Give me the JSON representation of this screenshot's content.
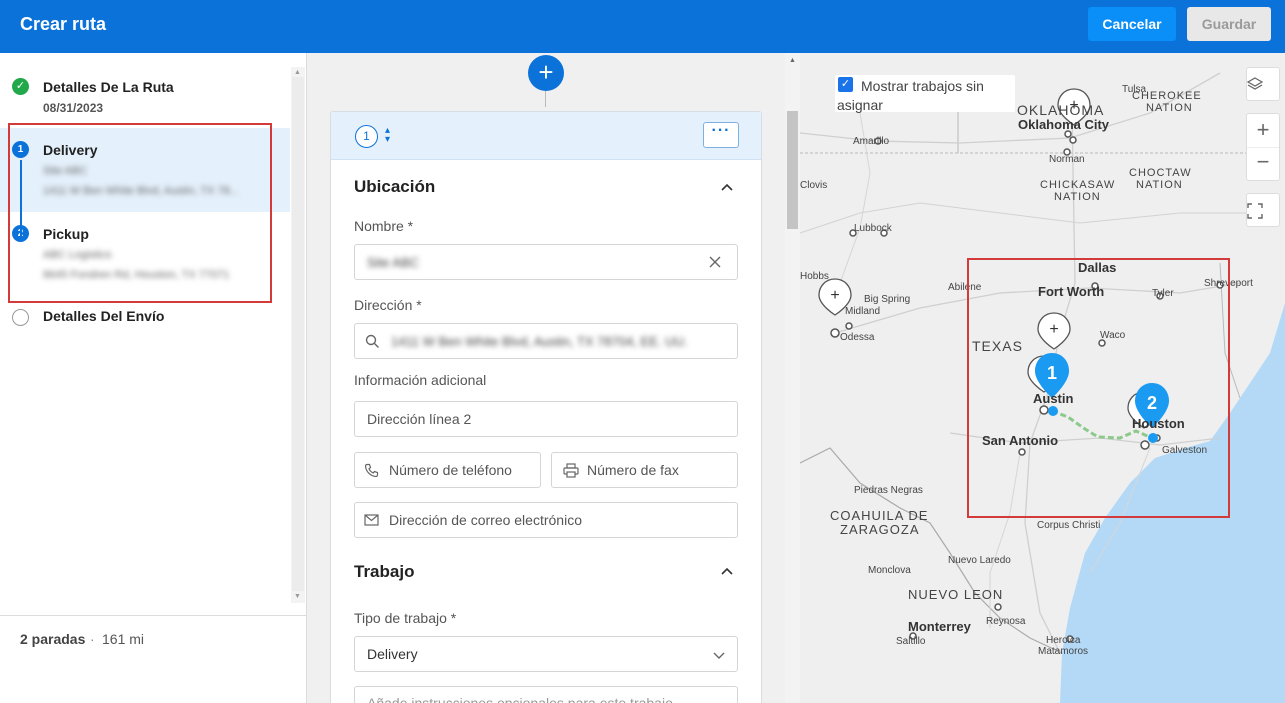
{
  "header": {
    "title": "Crear ruta",
    "cancel_label": "Cancelar",
    "save_label": "Guardar"
  },
  "sidebar": {
    "steps": [
      {
        "label": "Detalles De La Ruta",
        "sub": "08/31/2023"
      },
      {
        "label": "Delivery",
        "number": "1",
        "line1": "Site ABC",
        "line2": "1411 W Ben White Blvd, Austin, TX 78..."
      },
      {
        "label": "Pickup",
        "number": "2",
        "line1": "ABC Logistics",
        "line2": "8645 Fondren Rd, Houston, TX 77071"
      },
      {
        "label": "Detalles Del Envío"
      }
    ],
    "footer": {
      "stops": "2 paradas",
      "separator": "·",
      "miles": "161 mi"
    }
  },
  "stop_card": {
    "number": "1",
    "more_label": "···",
    "location": {
      "title": "Ubicación",
      "name_label": "Nombre *",
      "name_value": "Site ABC",
      "address_label": "Dirección *",
      "address_value": "1411 W Ben White Blvd, Austin, TX 78704, EE. UU.",
      "extra_label": "Información adicional",
      "line2_placeholder": "Dirección línea 2",
      "phone_placeholder": "Número de teléfono",
      "fax_placeholder": "Número de fax",
      "email_placeholder": "Dirección de correo electrónico"
    },
    "job": {
      "title": "Trabajo",
      "type_label": "Tipo de trabajo *",
      "type_value": "Delivery",
      "instructions_placeholder": "Añade instrucciones opcionales para este trabajo"
    }
  },
  "map": {
    "show_unassigned_label": "Mostrar trabajos sin asignar",
    "show_unassigned_checked": true,
    "labels": {
      "oklahoma": "OKLAHOMA",
      "oklahoma_city": "Oklahoma City",
      "norman": "Norman",
      "amarillo": "Amarillo",
      "clovis": "Clovis",
      "lubbock": "Lubbock",
      "hobbs": "Hobbs",
      "midland": "Midland",
      "odessa": "Odessa",
      "big_spring": "Big Spring",
      "abilene": "Abilene",
      "dallas": "Dallas",
      "fort_worth": "Fort Worth",
      "tyler": "Tyler",
      "shreveport": "Shreveport",
      "waco": "Waco",
      "texas": "TEXAS",
      "austin": "Austin",
      "san_antonio": "San Antonio",
      "houston": "Houston",
      "galveston": "Galveston",
      "tulsa": "Tulsa",
      "cherokee": "CHEROKEE",
      "nation": "NATION",
      "chickasaw": "CHICKASAW",
      "choctaw": "CHOCTAW",
      "piedras_negras": "Piedras Negras",
      "coahuila": "COAHUILA DE",
      "zaragoza": "ZARAGOZA",
      "corpus_christi": "Corpus Christi",
      "nuevo_laredo": "Nuevo Laredo",
      "monclova": "Monclova",
      "nuevo_leon": "NUEVO LEON",
      "monterrey": "Monterrey",
      "saltillo": "Saltillo",
      "reynosa": "Reynosa",
      "heroica": "Heroica",
      "matamoros": "Matamoros"
    },
    "markers": [
      {
        "label": "1",
        "color": "#1a9af0"
      },
      {
        "label": "2",
        "color": "#1a9af0"
      }
    ],
    "route_color": "#8cc98a",
    "water_color": "#b3d9f7"
  }
}
